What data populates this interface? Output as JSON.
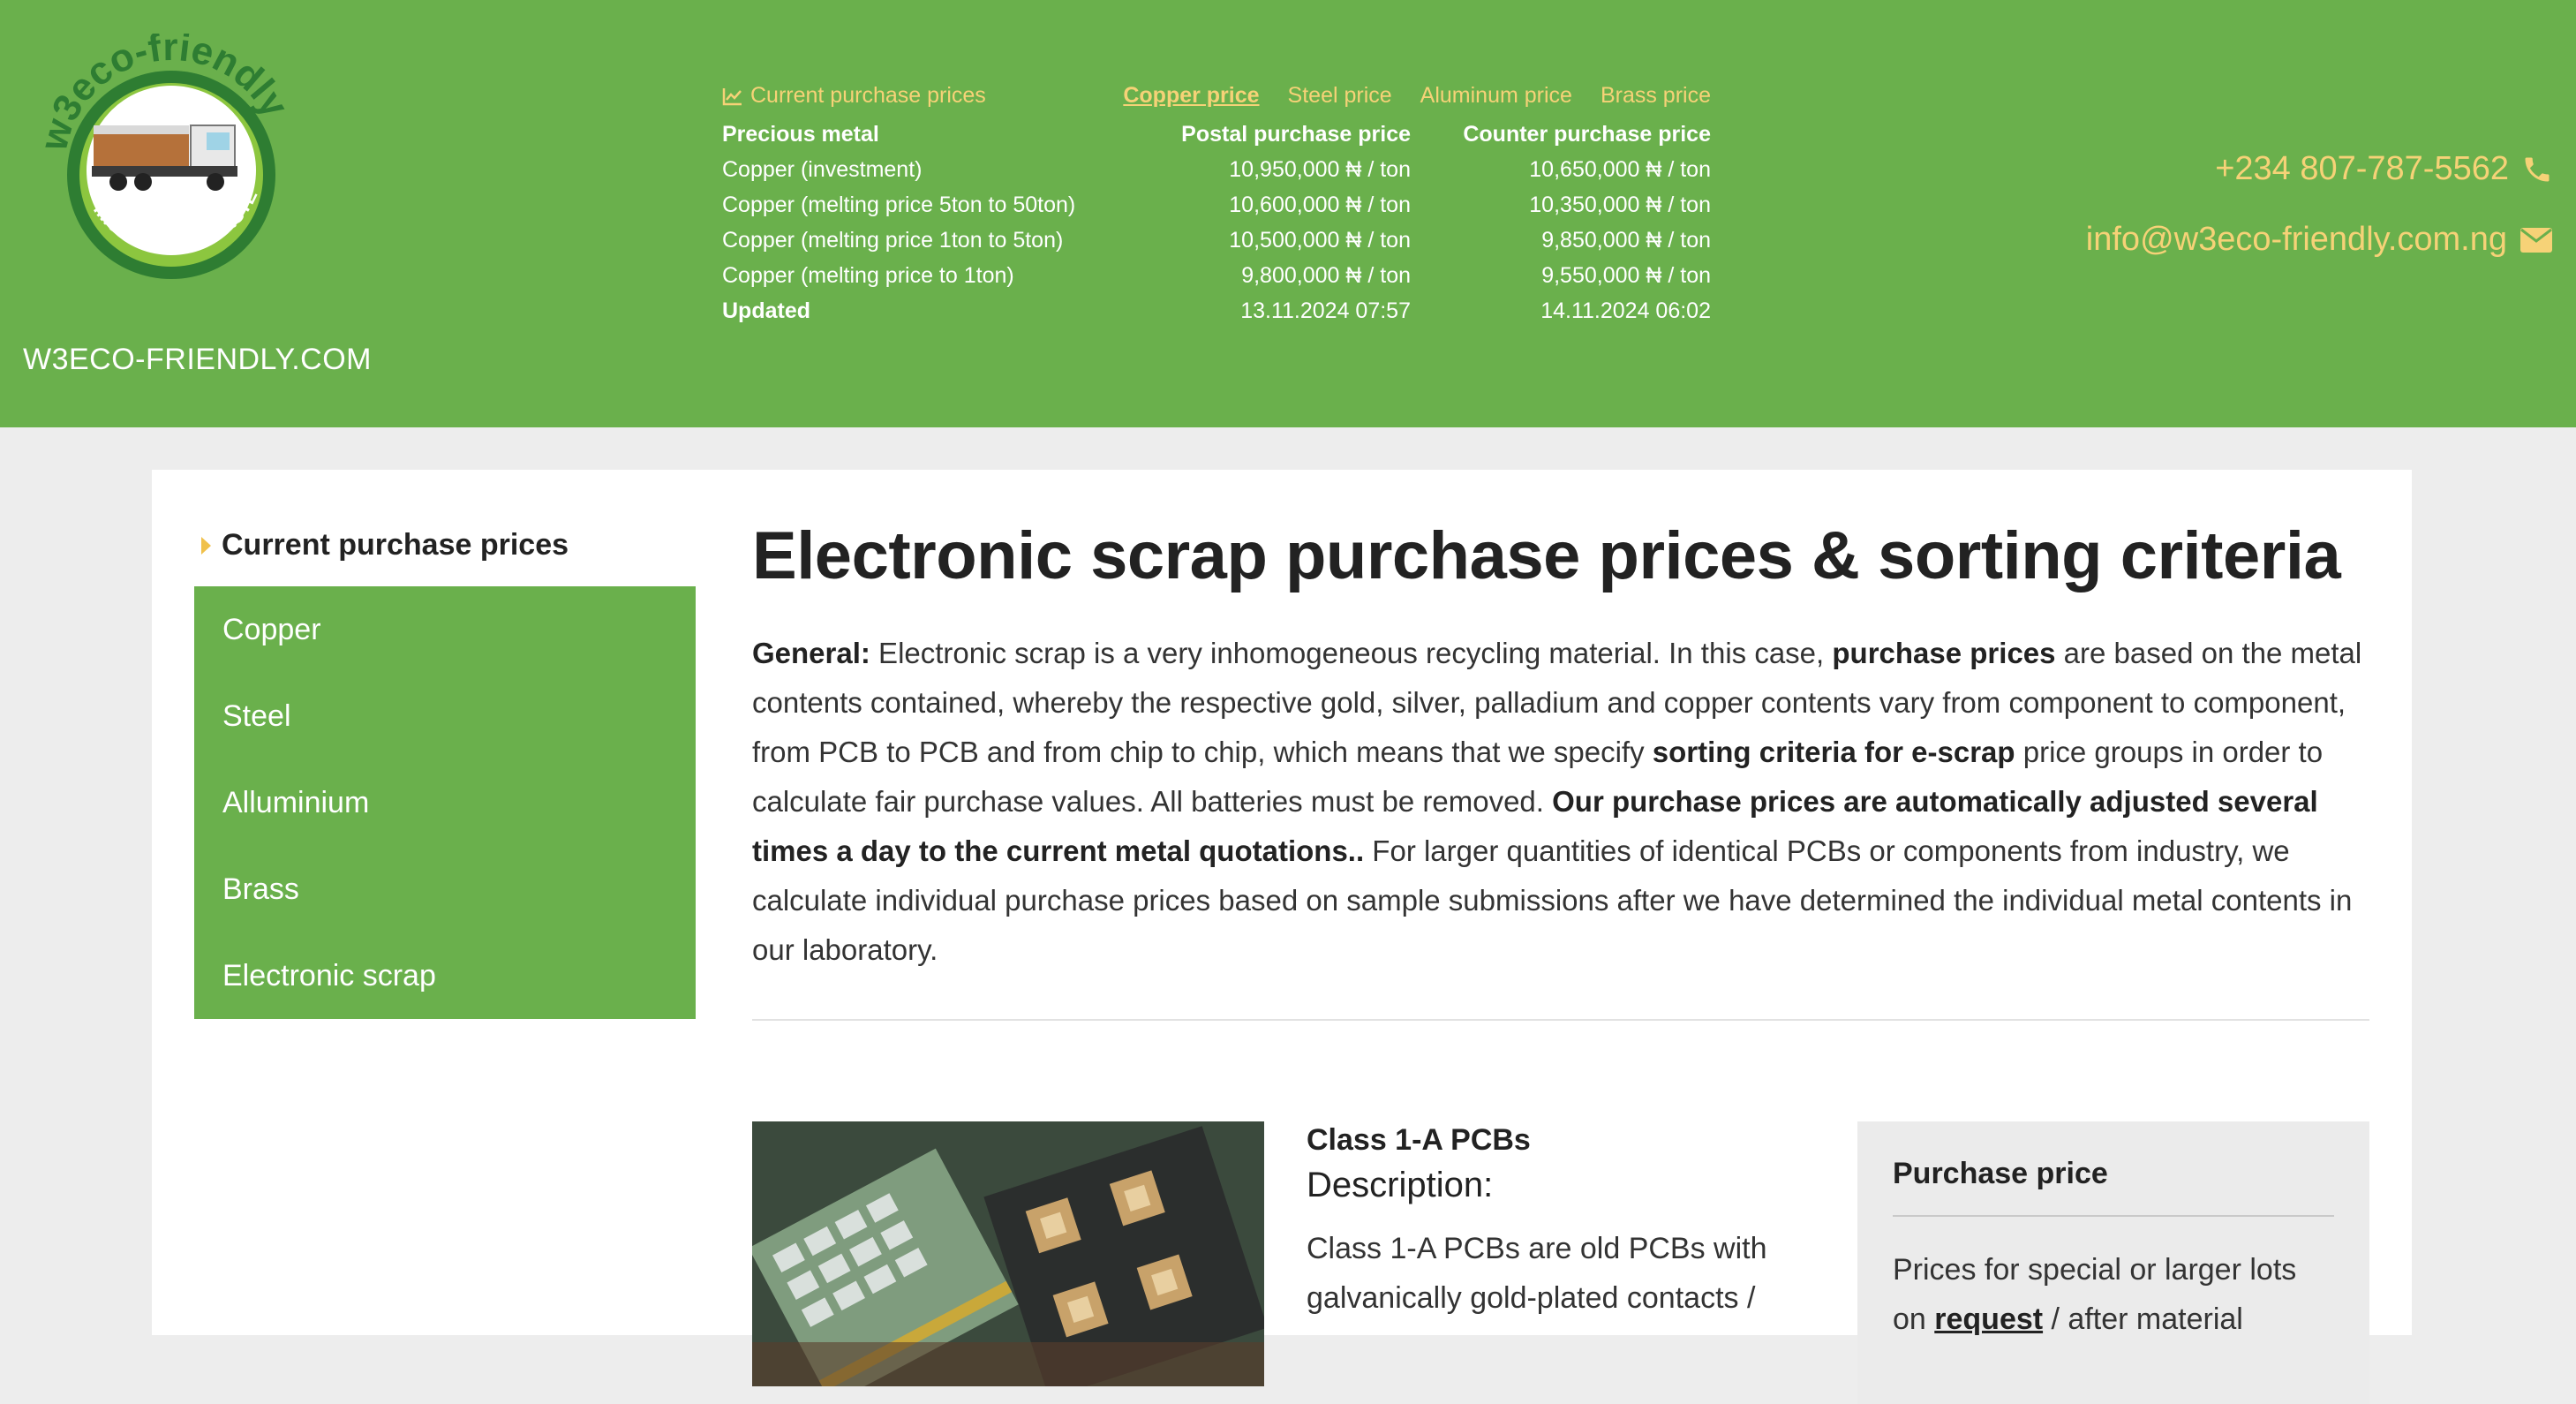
{
  "header": {
    "logo": {
      "brand_text": "w3eco-friendly",
      "tagline": "...NOTHING IS WASTE"
    },
    "site_name": "W3ECO-FRIENDLY.COM",
    "prices_widget": {
      "title": "Current purchase prices",
      "tabs": [
        {
          "label": "Copper price",
          "active": true
        },
        {
          "label": "Steel price",
          "active": false
        },
        {
          "label": "Aluminum price",
          "active": false
        },
        {
          "label": "Brass price",
          "active": false
        }
      ],
      "columns": [
        "Precious metal",
        "Postal purchase price",
        "Counter purchase price"
      ],
      "rows": [
        {
          "metal": "Copper (investment)",
          "postal": "10,950,000 ₦ / ton",
          "counter": "10,650,000 ₦ / ton"
        },
        {
          "metal": "Copper (melting price 5ton to 50ton)",
          "postal": "10,600,000 ₦ / ton",
          "counter": "10,350,000 ₦ / ton"
        },
        {
          "metal": "Copper (melting price 1ton to 5ton)",
          "postal": "10,500,000 ₦ / ton",
          "counter": "9,850,000 ₦ / ton"
        },
        {
          "metal": "Copper (melting price to 1ton)",
          "postal": "9,800,000 ₦ / ton",
          "counter": "9,550,000 ₦ / ton"
        }
      ],
      "updated_label": "Updated",
      "updated_postal": "13.11.2024 07:57",
      "updated_counter": "14.11.2024 06:02"
    },
    "phone": "+234 807-787-5562",
    "email": "info@w3eco-friendly.com.ng"
  },
  "sidebar": {
    "title": "Current purchase prices",
    "items": [
      {
        "label": "Copper"
      },
      {
        "label": "Steel"
      },
      {
        "label": "Alluminium"
      },
      {
        "label": "Brass"
      },
      {
        "label": "Electronic scrap"
      }
    ]
  },
  "main": {
    "title": "Electronic scrap purchase prices & sorting criteria",
    "intro": {
      "general_label": "General:",
      "t1": " Electronic scrap is a very inhomogeneous recycling material. In this case, ",
      "b1": "purchase prices",
      "t2": " are based on the metal contents contained, whereby the respective gold, silver, palladium and copper contents vary from component to component, from PCB to PCB and from chip to chip, which means that we specify ",
      "b2": "sorting criteria for e-scrap",
      "t3": " price groups in order to calculate fair purchase values. All batteries must be removed.  ",
      "b3": "Our purchase prices are automatically adjusted several times a day to the current metal quotations..",
      "t4": " For larger quantities of identical PCBs or components from industry, we calculate individual purchase prices based on sample submissions after we have determined the individual metal contents in our laboratory."
    },
    "item": {
      "class_title": "Class 1-A PCBs",
      "description_label": "Description:",
      "description_text": "Class 1-A PCBs are old PCBs with galvanically gold-plated contacts /"
    },
    "purchase_box": {
      "title": "Purchase price",
      "text_before": "Prices for special or larger lots on ",
      "link": "request",
      "text_after": " / after material"
    }
  },
  "colors": {
    "brand_green": "#6ab04c",
    "accent_yellow": "#f6d277",
    "page_bg": "#ededed"
  }
}
